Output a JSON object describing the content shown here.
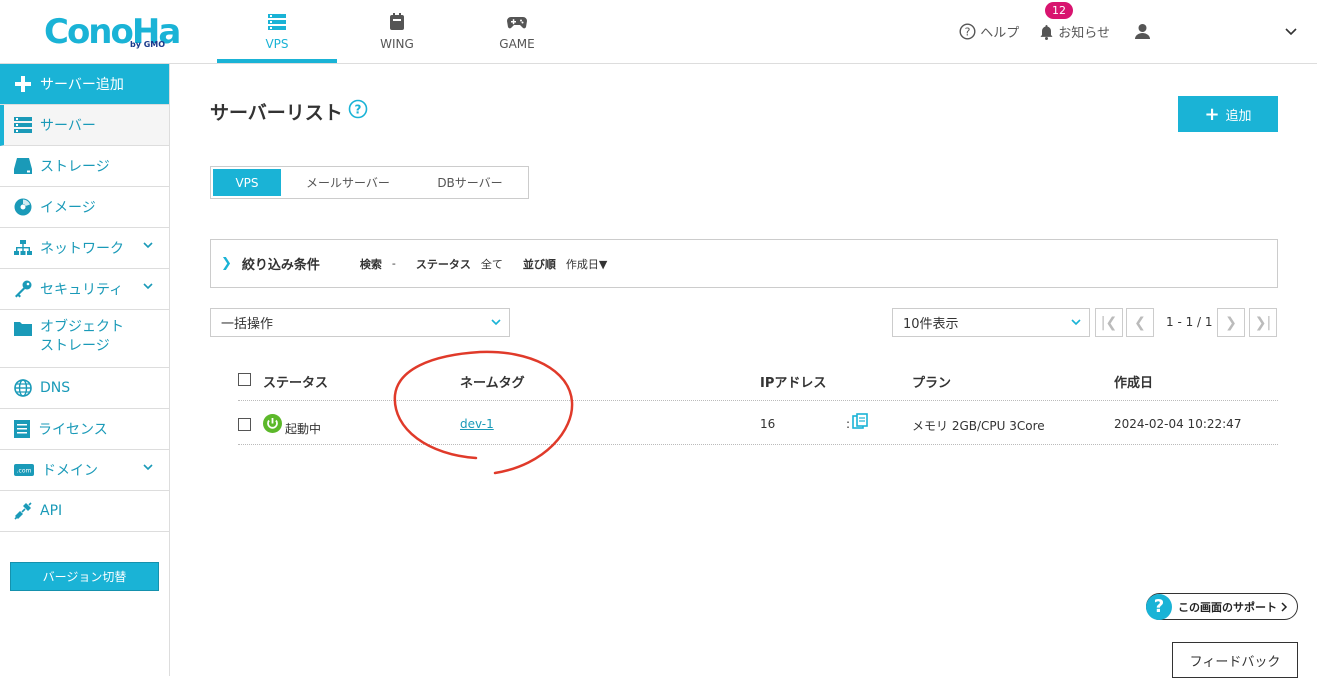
{
  "header": {
    "logo": "ConoHa",
    "logo_by": "by GMO",
    "tabs": [
      {
        "label": "VPS",
        "icon": "server-icon",
        "active": true
      },
      {
        "label": "WING",
        "icon": "wing-icon",
        "active": false
      },
      {
        "label": "GAME",
        "icon": "gamepad-icon",
        "active": false
      }
    ],
    "help_label": "ヘルプ",
    "notice_label": "お知らせ",
    "notice_count": "12",
    "accent_color": "#1ab3d6",
    "badge_color": "#d8146f"
  },
  "sidebar": {
    "add_label": "サーバー追加",
    "items": [
      {
        "label": "サーバー",
        "icon": "server-list-icon"
      },
      {
        "label": "ストレージ",
        "icon": "storage-icon"
      },
      {
        "label": "イメージ",
        "icon": "image-disc-icon"
      },
      {
        "label": "ネットワーク",
        "icon": "network-icon"
      },
      {
        "label": "セキュリティ",
        "icon": "key-icon"
      },
      {
        "label": "オブジェクト",
        "label2": "ストレージ",
        "icon": "folder-icon"
      },
      {
        "label": "DNS",
        "icon": "globe-icon"
      },
      {
        "label": "ライセンス",
        "icon": "license-icon"
      },
      {
        "label": "ドメイン",
        "icon": "domain-icon"
      },
      {
        "label": "API",
        "icon": "api-icon"
      }
    ],
    "version_label": "バージョン切替"
  },
  "main": {
    "title": "サーバーリスト",
    "add_label": "追加",
    "segments": [
      "VPS",
      "メールサーバー",
      "DBサーバー"
    ],
    "filter": {
      "title": "絞り込み条件",
      "search_key": "検索",
      "search_val": "-",
      "status_key": "ステータス",
      "status_val": "全て",
      "order_key": "並び順",
      "order_val": "作成日▼"
    },
    "bulk_select": "一括操作",
    "per_page_select": "10件表示",
    "page_indicator": "1 - 1 / 1",
    "table": {
      "headers": [
        "ステータス",
        "ネームタグ",
        "IPアドレス",
        "プラン",
        "作成日"
      ],
      "rows": [
        {
          "status": "起動中",
          "nametag": "dev-1",
          "ip": "16",
          "ip_suffix": ":",
          "plan": "メモリ 2GB/CPU 3Core",
          "created": "2024-02-04 10:22:47"
        }
      ]
    }
  },
  "support_label": "この画面のサポート",
  "feedback_label": "フィードバック"
}
